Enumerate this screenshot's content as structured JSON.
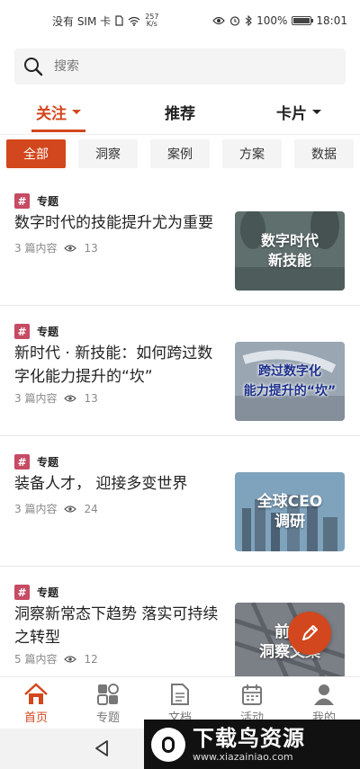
{
  "status_bar": {
    "carrier": "没有 SIM 卡",
    "net_speed_value": "257",
    "net_speed_unit": "K/s",
    "battery": "100%",
    "battery_level": 1.0,
    "time": "18:01"
  },
  "search": {
    "placeholder": "搜索"
  },
  "top_tabs": [
    {
      "label": "关注",
      "active": true,
      "has_caret": true
    },
    {
      "label": "推荐",
      "active": false,
      "has_caret": false
    },
    {
      "label": "卡片",
      "active": false,
      "has_caret": true
    }
  ],
  "filters": [
    {
      "label": "全部",
      "active": true
    },
    {
      "label": "洞察",
      "active": false
    },
    {
      "label": "案例",
      "active": false
    },
    {
      "label": "方案",
      "active": false
    },
    {
      "label": "数据",
      "active": false
    }
  ],
  "cards": [
    {
      "tag_icon": "#",
      "tag": "专题",
      "title": "数字时代的技能提升尤为重要",
      "count": "3 篇内容",
      "views": "13",
      "thumb_text": [
        "数字时代",
        "新技能"
      ],
      "thumb_color": "#5f6f6e"
    },
    {
      "tag_icon": "#",
      "tag": "专题",
      "title": "新时代 · 新技能：如何跨过数字化能力提升的“坎”",
      "count": "3 篇内容",
      "views": "13",
      "thumb_text": [
        "跨过数字化",
        "能力提升的“坎”"
      ],
      "thumb_color": "#8d9aa6"
    },
    {
      "tag_icon": "#",
      "tag": "专题",
      "title": "装备人才， 迎接多变世界",
      "count": "3 篇内容",
      "views": "24",
      "thumb_text": [
        "全球CEO",
        "调研"
      ],
      "thumb_color": "#6f8fa6"
    },
    {
      "tag_icon": "#",
      "tag": "专题",
      "title": "洞察新常态下趋势 落实可持续之转型",
      "count": "5 篇内容",
      "views": "12",
      "thumb_text": [
        "前瞻",
        "洞察文集"
      ],
      "thumb_color": "#7b7f86"
    }
  ],
  "bottom_nav": [
    {
      "label": "首页",
      "icon": "home-icon",
      "active": true
    },
    {
      "label": "专题",
      "icon": "grid-icon",
      "active": false
    },
    {
      "label": "文档",
      "icon": "document-icon",
      "active": false
    },
    {
      "label": "活动",
      "icon": "calendar-icon",
      "active": false
    },
    {
      "label": "我的",
      "icon": "user-icon",
      "active": false
    }
  ],
  "watermark": {
    "title": "下载鸟资源",
    "url": "www.xiazainiao.com"
  },
  "colors": {
    "accent": "#d2471d",
    "tag": "#c64b63"
  }
}
